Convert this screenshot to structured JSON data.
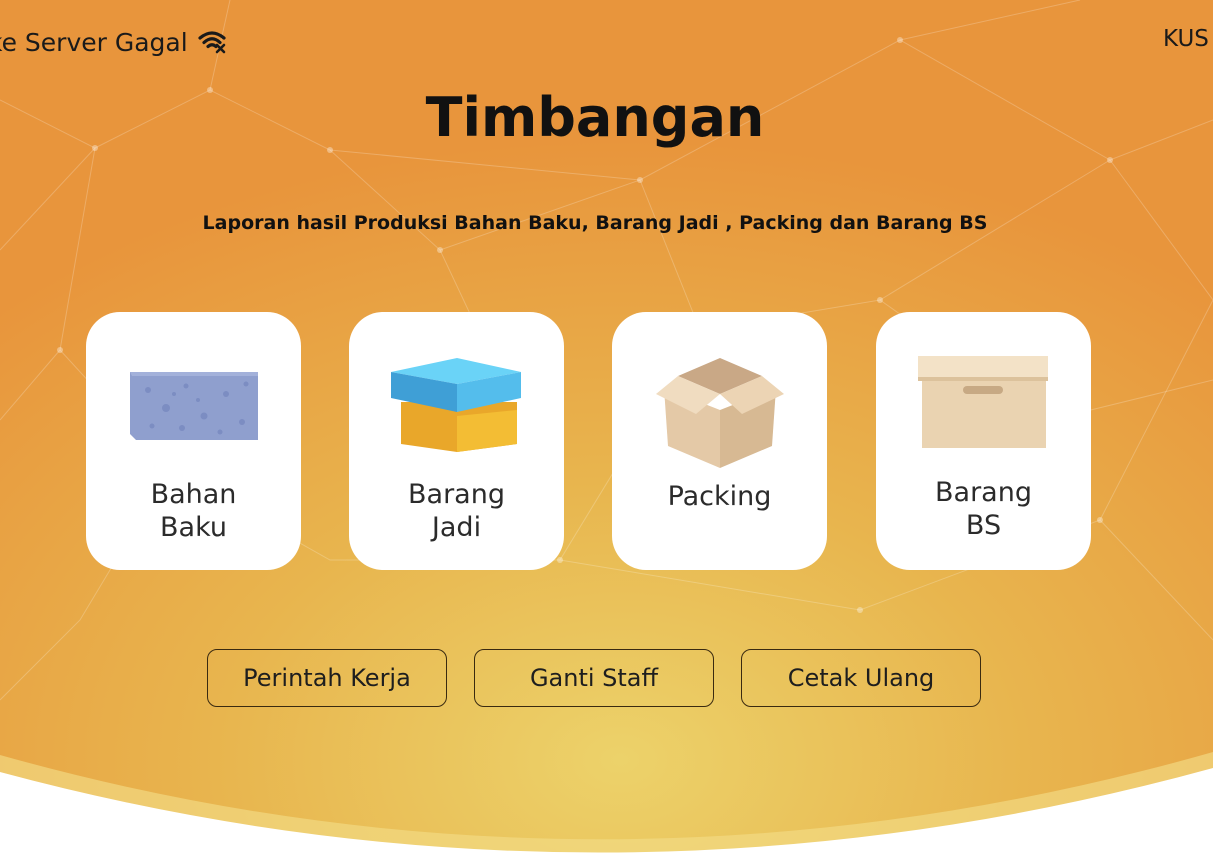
{
  "status": {
    "text": "ke Server Gagal",
    "icon": "wifi-off-icon"
  },
  "user": {
    "label": "KUS"
  },
  "page": {
    "title": "Timbangan",
    "subtitle": "Laporan hasil Produksi Bahan Baku, Barang Jadi , Packing dan Barang BS"
  },
  "cards": [
    {
      "line1": "Bahan",
      "line2": "Baku",
      "icon": "foam-block-icon"
    },
    {
      "line1": "Barang",
      "line2": "Jadi",
      "icon": "gift-box-icon"
    },
    {
      "line1": "Packing",
      "line2": "",
      "icon": "open-cardboard-box-icon"
    },
    {
      "line1": "Barang",
      "line2": "BS",
      "icon": "storage-box-icon"
    }
  ],
  "actions": [
    {
      "label": "Perintah Kerja"
    },
    {
      "label": "Ganti Staff"
    },
    {
      "label": "Cetak Ulang"
    }
  ],
  "colors": {
    "background_top": "#e8953c",
    "background_bottom": "#ecd26a",
    "card": "#ffffff",
    "text": "#111111"
  }
}
